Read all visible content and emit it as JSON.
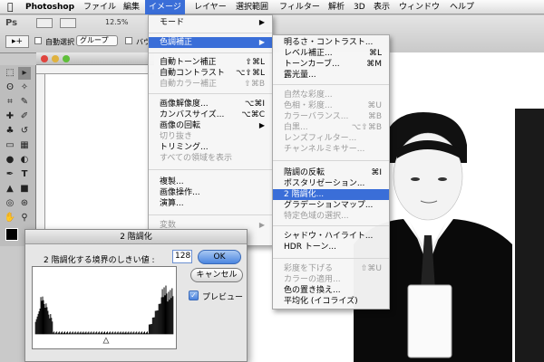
{
  "menubar": {
    "apple_icon": "apple-icon",
    "app_name": "Photoshop",
    "items": [
      "ファイル",
      "編集",
      "イメージ",
      "レイヤー",
      "選択範囲",
      "フィルター",
      "解析",
      "3D",
      "表示",
      "ウィンドウ",
      "ヘルプ"
    ]
  },
  "optionsbar": {
    "zoom": "12.5%",
    "auto_select_label": "自動選択 :",
    "group_value": "グループ",
    "overflow_text": "バウ"
  },
  "image_menu": {
    "items": [
      {
        "label": "モード",
        "submenu": true
      },
      {
        "label": "色調補正",
        "submenu": true,
        "highlighted": true
      },
      {
        "label": "自動トーン補正",
        "shortcut": "⇧⌘L"
      },
      {
        "label": "自動コントラスト",
        "shortcut": "⌥⇧⌘L"
      },
      {
        "label": "自動カラー補正",
        "shortcut": "⇧⌘B",
        "disabled": true
      },
      {
        "label": "画像解像度...",
        "shortcut": "⌥⌘I"
      },
      {
        "label": "カンバスサイズ...",
        "shortcut": "⌥⌘C"
      },
      {
        "label": "画像の回転",
        "submenu": true
      },
      {
        "label": "切り抜き",
        "disabled": true
      },
      {
        "label": "トリミング..."
      },
      {
        "label": "すべての領域を表示",
        "disabled": true
      },
      {
        "label": "複製..."
      },
      {
        "label": "画像操作..."
      },
      {
        "label": "演算..."
      },
      {
        "label": "変数",
        "submenu": true,
        "disabled": true
      }
    ]
  },
  "adjust_menu": {
    "items": [
      {
        "label": "明るさ・コントラスト..."
      },
      {
        "label": "レベル補正...",
        "shortcut": "⌘L"
      },
      {
        "label": "トーンカーブ...",
        "shortcut": "⌘M"
      },
      {
        "label": "露光量..."
      },
      {
        "label": "自然な彩度...",
        "disabled": true
      },
      {
        "label": "色相・彩度...",
        "shortcut": "⌘U",
        "disabled": true
      },
      {
        "label": "カラーバランス...",
        "shortcut": "⌘B",
        "disabled": true
      },
      {
        "label": "白黒...",
        "shortcut": "⌥⇧⌘B",
        "disabled": true
      },
      {
        "label": "レンズフィルター...",
        "disabled": true
      },
      {
        "label": "チャンネルミキサー...",
        "disabled": true
      },
      {
        "label": "階調の反転",
        "shortcut": "⌘I"
      },
      {
        "label": "ポスタリゼーション..."
      },
      {
        "label": "2 階調化...",
        "highlighted": true
      },
      {
        "label": "グラデーションマップ..."
      },
      {
        "label": "特定色域の選択...",
        "disabled": true
      },
      {
        "label": "シャドウ・ハイライト..."
      },
      {
        "label": "HDR トーン..."
      },
      {
        "label": "彩度を下げる",
        "shortcut": "⇧⌘U",
        "disabled": true
      },
      {
        "label": "カラーの適用...",
        "disabled": true
      },
      {
        "label": "色の置き換え..."
      },
      {
        "label": "平均化 (イコライズ)"
      }
    ]
  },
  "threshold_dialog": {
    "title": "2 階調化",
    "threshold_label": "2 階調化する境界のしきい値 :",
    "threshold_value": "128",
    "ok_label": "OK",
    "cancel_label": "キャンセル",
    "preview_label": "プレビュー",
    "preview_checked": true
  },
  "colors": {
    "accent": "#3a6ed8",
    "disabled_text": "#9a9a9a"
  }
}
